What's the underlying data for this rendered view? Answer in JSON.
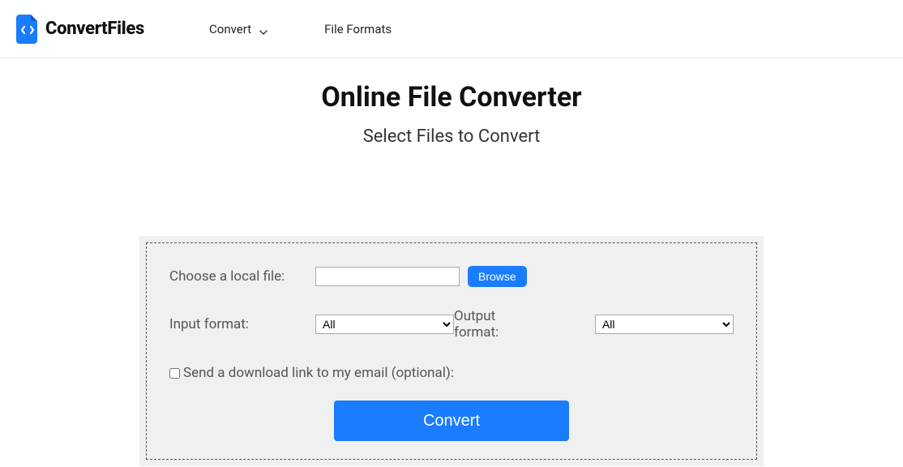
{
  "header": {
    "logo_text": "ConvertFiles",
    "nav": {
      "convert": "Convert",
      "file_formats": "File Formats"
    }
  },
  "main": {
    "title": "Online File Converter",
    "subtitle": "Select Files to Convert"
  },
  "form": {
    "choose_file_label": "Choose a local file:",
    "browse_button": "Browse",
    "input_format_label": "Input format:",
    "input_format_value": "All",
    "output_format_label": "Output format:",
    "output_format_value": "All",
    "email_checkbox_label": "Send a download link to my email (optional):",
    "convert_button": "Convert"
  }
}
